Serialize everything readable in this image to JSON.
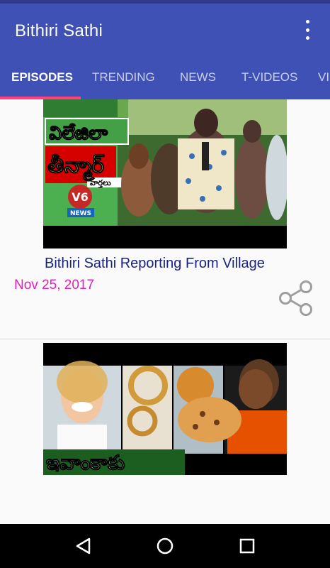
{
  "app": {
    "title": "Bithiri Sathi",
    "primary_color": "#3f51b5",
    "accent_color": "#ff4081"
  },
  "toolbar": {
    "overflow_icon": "more-vert-icon"
  },
  "tabs": [
    {
      "label": "EPISODES",
      "active": true
    },
    {
      "label": "TRENDING",
      "active": false
    },
    {
      "label": "NEWS",
      "active": false
    },
    {
      "label": "T-VIDEOS",
      "active": false
    },
    {
      "label": "VI",
      "active": false
    }
  ],
  "videos": [
    {
      "thumb_caption_top": "విలేజిలా",
      "thumb_caption_main": "తీన్మార్",
      "thumb_caption_sub": "వార్తలు",
      "channel_logo": "V6",
      "channel_logo_sub": "NEWS",
      "title": "Bithiri Sathi Reporting From Village",
      "date": "Nov 25, 2017",
      "share_icon": "share-icon"
    },
    {
      "thumb_caption_main": "ఇవాంకాకు",
      "title": "",
      "date": ""
    }
  ],
  "navbar": {
    "back_icon": "back-triangle-icon",
    "home_icon": "home-circle-icon",
    "recents_icon": "recents-square-icon"
  }
}
